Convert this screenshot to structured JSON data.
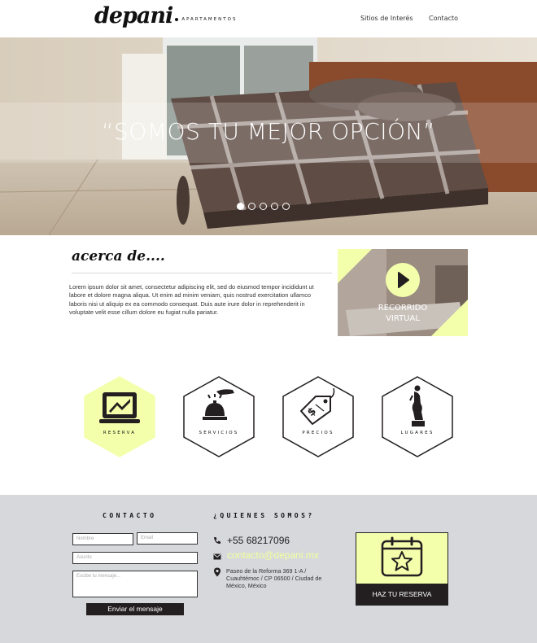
{
  "header": {
    "logo_text": "depani",
    "logo_sub": "APARTAMENTOS",
    "nav": [
      {
        "label": "Sitios de Interés"
      },
      {
        "label": "Contacto"
      }
    ]
  },
  "hero": {
    "title": "“SOMOS TU MEJOR OPCIÓN”",
    "slides_total": 5,
    "active_slide": 1
  },
  "about": {
    "title": "acerca de....",
    "text": "Lorem ipsum dolor sit amet, consectetur adipiscing elit, sed do eiusmod tempor incididunt ut labore et dolore magna aliqua. Ut enim ad minim veniam, quis nostrud exercitation ullamco laboris nisi ut aliquip ex ea commodo consequat. Duis aute irure dolor in reprehenderit in voluptate velit esse cillum dolore eu fugiat nulla pariatur.",
    "video_line1": "RECORRIDO",
    "video_line2": "VIRTUAL"
  },
  "features": [
    {
      "label": "RESERVA",
      "icon": "laptop-icon",
      "highlighted": true
    },
    {
      "label": "SERVICIOS",
      "icon": "reception-bell-icon",
      "highlighted": false
    },
    {
      "label": "PRECIOS",
      "icon": "price-tag-icon",
      "highlighted": false
    },
    {
      "label": "LUGARES",
      "icon": "statue-icon",
      "highlighted": false
    }
  ],
  "footer": {
    "contact_heading": "CONTACTO",
    "about_heading": "¿QUIENES SOMOS?",
    "name_placeholder": "Nombre",
    "email_placeholder": "Email",
    "subject_placeholder": "Asunto",
    "message_placeholder": "Escibe tu mensaje...",
    "send_label": "Enviar el mensaje",
    "phone": "+55 68217096",
    "email": "contacto@depani.mx",
    "address": "Paseo de la Reforma 369 1-A / Cuauhtémoc / CP 06500 / Ciudad de México, México",
    "reserve_label": "HAZ TU RESERVA"
  },
  "colors": {
    "accent": "#f3ffab",
    "dark": "#231f20",
    "footer_bg": "#d7d8dc"
  }
}
